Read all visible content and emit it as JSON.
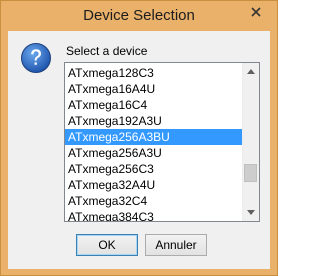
{
  "window": {
    "title": "Device Selection",
    "close_icon": "close-icon"
  },
  "dialog": {
    "icon": "question-icon",
    "prompt": "Select a device",
    "devices": [
      "ATxmega128C3",
      "ATxmega16A4U",
      "ATxmega16C4",
      "ATxmega192A3U",
      "ATxmega256A3BU",
      "ATxmega256A3U",
      "ATxmega256C3",
      "ATxmega32A4U",
      "ATxmega32C4",
      "ATxmega384C3"
    ],
    "selected_device": "ATxmega256A3BU",
    "ok_label": "OK",
    "cancel_label": "Annuler"
  },
  "colors": {
    "frame": "#e9b16a",
    "selection": "#3399ff"
  }
}
